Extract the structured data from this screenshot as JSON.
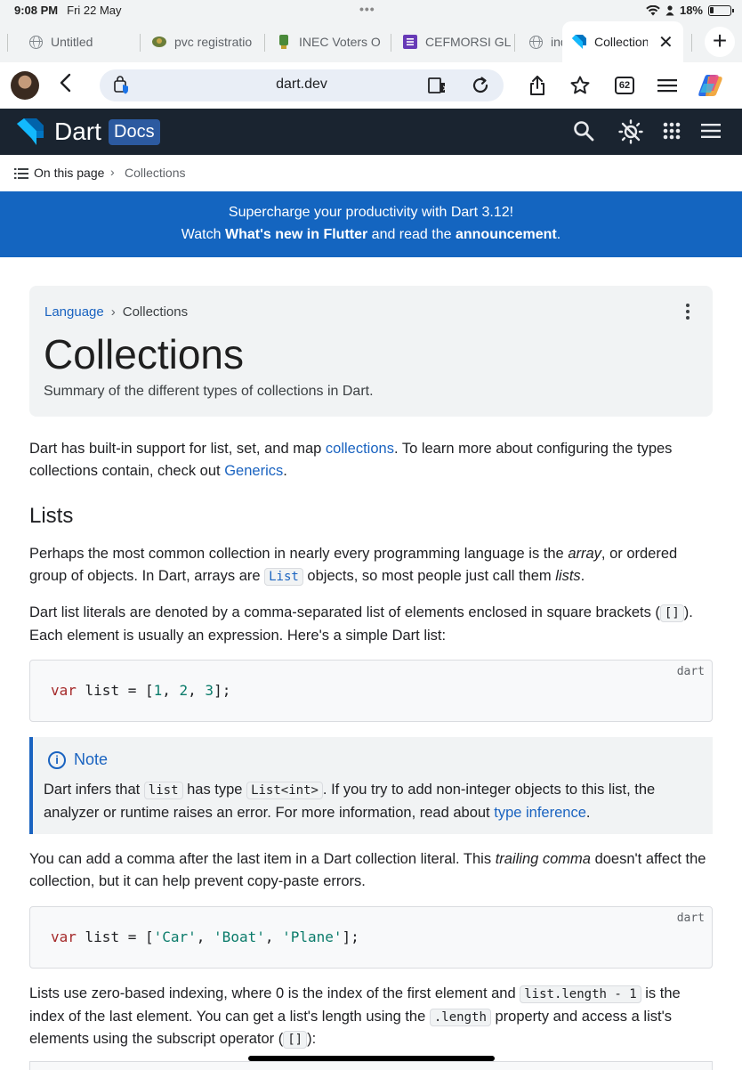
{
  "status": {
    "time": "9:08 PM",
    "date": "Fri 22 May",
    "battery": "18%"
  },
  "tabs": [
    {
      "title": "Untitled"
    },
    {
      "title": "pvc registratio"
    },
    {
      "title": "INEC Voters O"
    },
    {
      "title": "CEFMORSI GL"
    },
    {
      "title": "ind"
    },
    {
      "title": "Collection"
    }
  ],
  "toolbar": {
    "url": "dart.dev",
    "tab_count": "62"
  },
  "site": {
    "brand": "Dart",
    "docs_label": "Docs"
  },
  "subnav": {
    "on_this_page": "On this page",
    "current": "Collections"
  },
  "banner": {
    "line1": "Supercharge your productivity with Dart 3.12!",
    "line2_prefix": "Watch ",
    "line2_link1": "What's new in Flutter",
    "line2_mid": " and read the ",
    "line2_link2": "announcement",
    "line2_suffix": "."
  },
  "page": {
    "breadcrumb_parent": "Language",
    "breadcrumb_current": "Collections",
    "title": "Collections",
    "subtitle": "Summary of the different types of collections in Dart."
  },
  "content": {
    "intro_a": "Dart has built-in support for list, set, and map ",
    "intro_link1": "collections",
    "intro_b": ". To learn more about configuring the types collections contain, check out ",
    "intro_link2": "Generics",
    "intro_c": ".",
    "h_lists": "Lists",
    "p1_a": "Perhaps the most common collection in nearly every programming language is the ",
    "p1_em1": "array",
    "p1_b": ", or ordered group of objects. In Dart, arrays are ",
    "p1_code": "List",
    "p1_c": " objects, so most people just call them ",
    "p1_em2": "lists",
    "p1_d": ".",
    "p2_a": "Dart list literals are denoted by a comma-separated list of elements enclosed in square brackets (",
    "p2_code": "[]",
    "p2_b": "). Each element is usually an expression. Here's a simple Dart list:",
    "code1_lang": "dart",
    "code1": {
      "kw": "var",
      "name": " list = [",
      "n1": "1",
      "c1": ", ",
      "n2": "2",
      "c2": ", ",
      "n3": "3",
      "end": "];"
    },
    "note_title": "Note",
    "note_a": "Dart infers that ",
    "note_code1": "list",
    "note_b": " has type ",
    "note_code2": "List<int>",
    "note_c": ". If you try to add non-integer objects to this list, the analyzer or runtime raises an error. For more information, read about ",
    "note_link": "type inference",
    "note_d": ".",
    "p3_a": "You can add a comma after the last item in a Dart collection literal. This ",
    "p3_em": "trailing comma",
    "p3_b": " doesn't affect the collection, but it can help prevent copy-paste errors.",
    "code2_lang": "dart",
    "code2": {
      "kw": "var",
      "name": " list = [",
      "s1": "'Car'",
      "c1": ", ",
      "s2": "'Boat'",
      "c2": ", ",
      "s3": "'Plane'",
      "end": "];"
    },
    "p4_a": "Lists use zero-based indexing, where 0 is the index of the first element and ",
    "p4_code1": "list.length - 1",
    "p4_b": " is the index of the last element. You can get a list's length using the ",
    "p4_code2": ".length",
    "p4_c": " property and access a list's elements using the subscript operator (",
    "p4_code3": "[]",
    "p4_d": "):"
  },
  "colors": {
    "header_bg": "#1a2430",
    "banner_bg": "#1465c0",
    "link": "#1a63c0"
  }
}
